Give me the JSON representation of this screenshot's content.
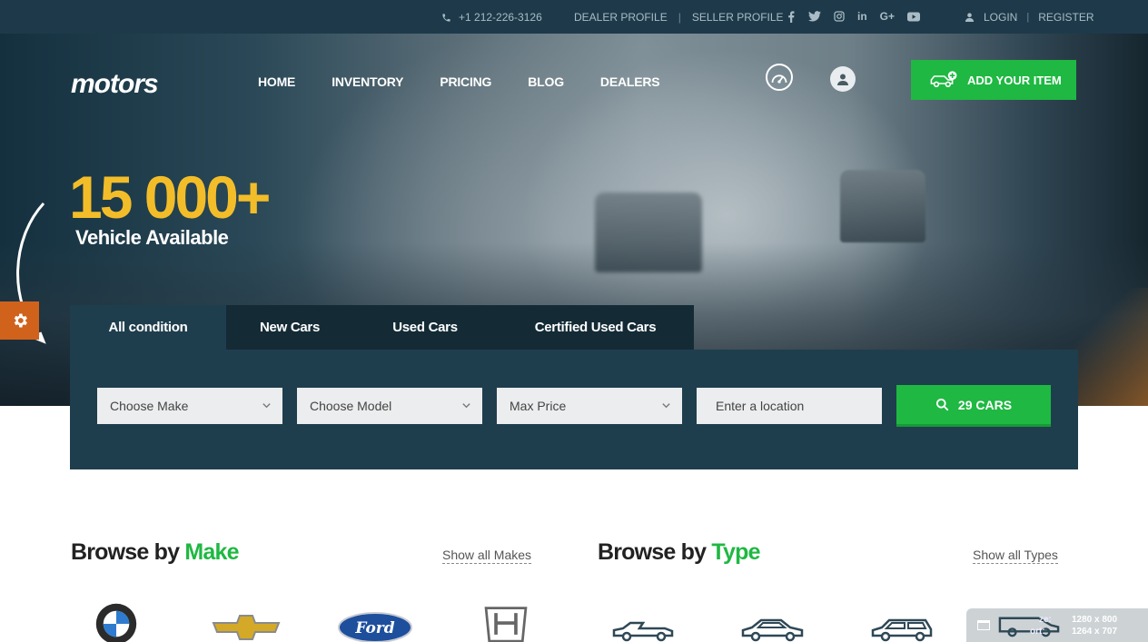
{
  "topbar": {
    "phone": "+1 212-226-3126",
    "links": [
      "DEALER PROFILE",
      "SELLER PROFILE"
    ],
    "socials": [
      "f",
      "t",
      "ig",
      "in",
      "G+",
      "yt"
    ],
    "login": "LOGIN",
    "register": "REGISTER"
  },
  "header": {
    "logo": "motors",
    "nav": [
      "HOME",
      "INVENTORY",
      "PRICING",
      "BLOG",
      "DEALERS"
    ],
    "add_item": "ADD YOUR ITEM"
  },
  "hero": {
    "count": "15 000+",
    "count_label": "Vehicle Available"
  },
  "search": {
    "tabs": [
      "All condition",
      "New Cars",
      "Used Cars",
      "Certified Used Cars"
    ],
    "active_tab": 0,
    "make": "Choose Make",
    "model": "Choose Model",
    "price": "Max Price",
    "location_placeholder": "Enter a location",
    "button": "29 CARS"
  },
  "browse": {
    "make_title": "Browse by",
    "make_accent": "Make",
    "make_show_all": "Show all Makes",
    "type_title": "Browse by",
    "type_accent": "Type",
    "type_show_all": "Show all Types"
  },
  "window_badge": {
    "line1_label": "ze:",
    "line1_value": "1280 x 800",
    "line2_label": "ort:",
    "line2_value": "1264 x 707"
  },
  "colors": {
    "accent_green": "#1fb842",
    "accent_yellow": "#f3bd29",
    "panel": "#1f3e4d",
    "topbar": "#1e3a4a",
    "gear_orange": "#d0621c"
  }
}
